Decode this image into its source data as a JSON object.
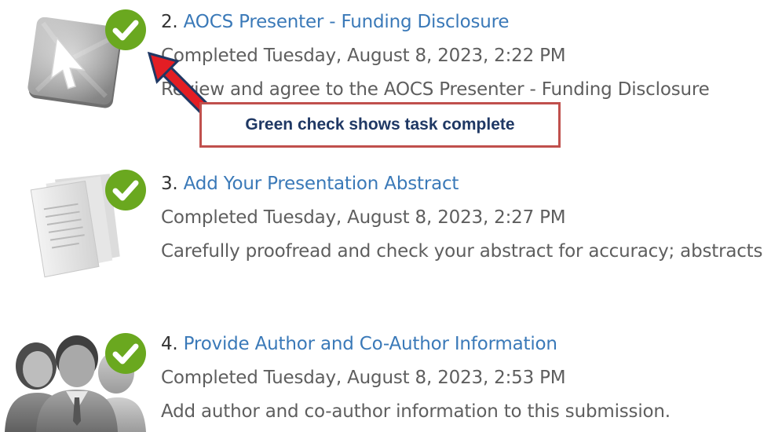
{
  "tasks": [
    {
      "number": "2.",
      "title": "AOCS Presenter - Funding Disclosure",
      "status": "Completed Tuesday, August 8, 2023, 2:22 PM",
      "description": "Review and agree to the AOCS Presenter - Funding Disclosure",
      "icon": "cursor-arrow-icon",
      "completed": true
    },
    {
      "number": "3.",
      "title": "Add Your Presentation Abstract",
      "status": "Completed Tuesday, August 8, 2023, 2:27 PM",
      "description": "Carefully proofread and check your abstract for accuracy; abstracts",
      "icon": "documents-icon",
      "completed": true
    },
    {
      "number": "4.",
      "title": "Provide Author and Co-Author Information",
      "status": "Completed Tuesday, August 8, 2023, 2:53 PM",
      "description": "Add author and co-author information to this submission.",
      "icon": "people-group-icon",
      "completed": true
    }
  ],
  "annotation": {
    "callout_text": "Green check shows task complete",
    "border_color": "#c0504d",
    "arrow_color": "#e31e24"
  },
  "colors": {
    "check_green": "#6aa81f",
    "link_blue": "#3a79b8"
  }
}
